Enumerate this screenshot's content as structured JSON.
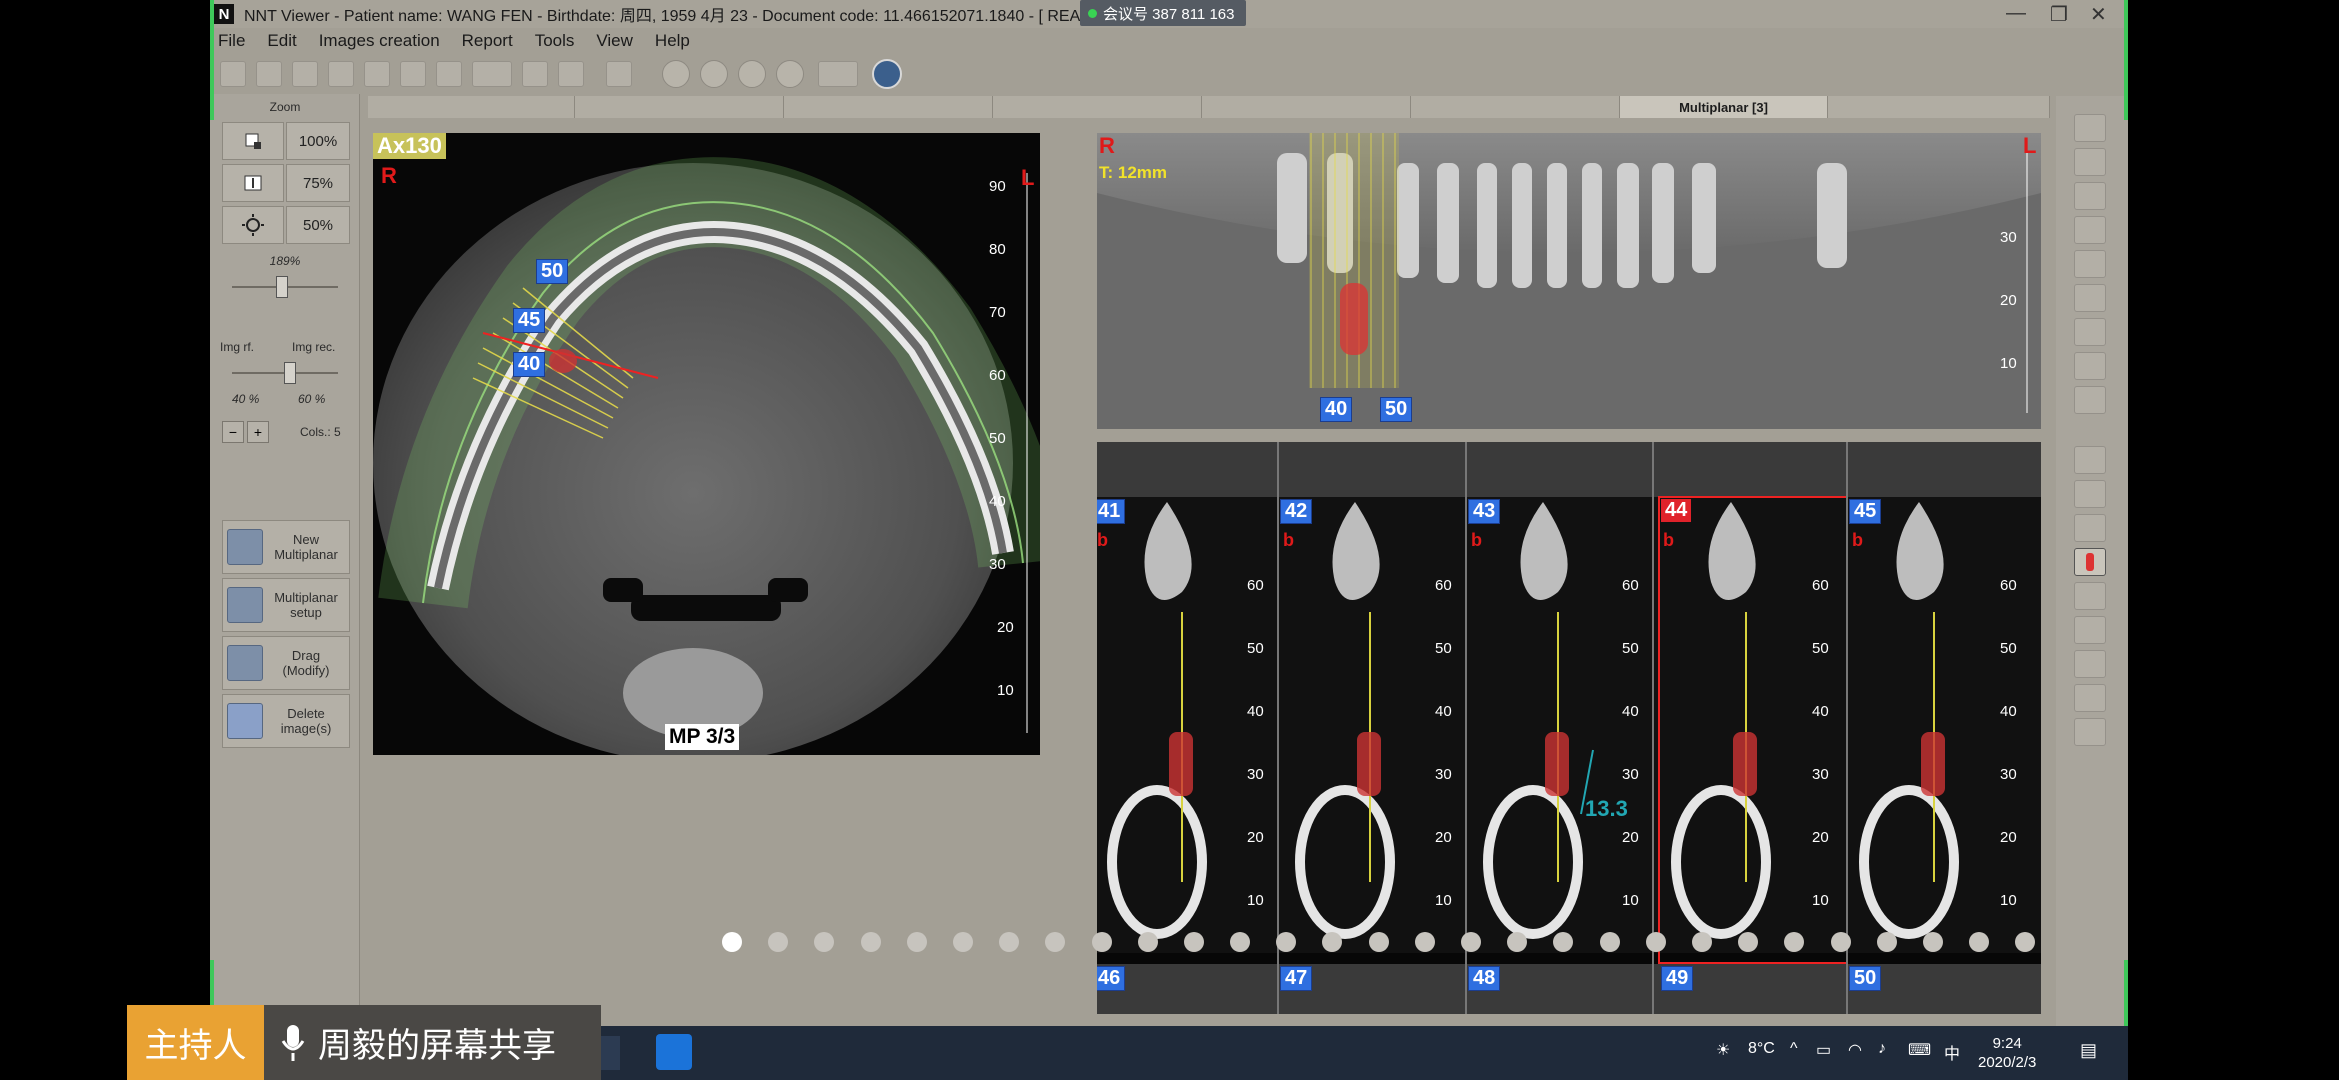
{
  "window": {
    "title": "NNT Viewer - Patient name: WANG FEN - Birthdate: 周四, 1959 4月 23 - Document code: 11.466152071.1840  -  [ REA",
    "meeting_badge": "会议号 387 811 163",
    "controls": [
      "—",
      "❐",
      "✕"
    ]
  },
  "menu": [
    "File",
    "Edit",
    "Images creation",
    "Report",
    "Tools",
    "View",
    "Help"
  ],
  "left_panel": {
    "zoom_title": "Zoom",
    "zoom_levels": [
      "100%",
      "75%",
      "50%"
    ],
    "zoom_value": "189%",
    "img_rf_label": "Img rf.",
    "img_rec_label": "Img rec.",
    "img_rf_value": "40 %",
    "img_rec_value": "60 %",
    "minus": "−",
    "plus": "+",
    "cols_label": "Cols.: 5",
    "buttons": [
      {
        "label": "New\nMultiplanar"
      },
      {
        "label": "Multiplanar\nsetup"
      },
      {
        "label": "Drag\n(Modify)"
      },
      {
        "label": "Delete\nimage(s)"
      }
    ]
  },
  "tabs": {
    "active_label": "Multiplanar [3]"
  },
  "axial": {
    "slice_label": "Ax130",
    "orientation_right": "R",
    "orientation_left": "L",
    "ruler_ticks": [
      "90",
      "80",
      "70",
      "60",
      "50",
      "40",
      "30",
      "20",
      "10"
    ],
    "section_tags": [
      "50",
      "45",
      "40"
    ],
    "mp_label": "MP 3/3"
  },
  "panoramic": {
    "orientation_right": "R",
    "orientation_left": "L",
    "thickness": "T: 12mm",
    "ruler_ticks": [
      "30",
      "20",
      "10"
    ],
    "section_tags": [
      "40",
      "50"
    ]
  },
  "cross_sections": {
    "top_row_tags": [
      "41",
      "42",
      "43",
      "44",
      "45"
    ],
    "highlighted_tag": "44",
    "bottom_row_tags": [
      "46",
      "47",
      "48",
      "49",
      "50"
    ],
    "side_letter": "b",
    "ruler_ticks": [
      "60",
      "50",
      "40",
      "30",
      "20",
      "10"
    ],
    "measurement": "13.3"
  },
  "pagination": {
    "count": 29,
    "active_index": 0
  },
  "meeting_overlay": {
    "host": "主持人",
    "sharing": "周毅的屏幕共享"
  },
  "taskbar": {
    "temperature": "8°C",
    "ime": "中",
    "time": "9:24",
    "date": "2020/2/3"
  },
  "colors": {
    "app_bg": "#a39f95",
    "tag_blue": "#2f6fe0",
    "tag_red": "#e0222a",
    "label_yellow": "#c7c25a",
    "overlay_orange": "#e9a233",
    "window_edge_green": "#3ec85a"
  }
}
